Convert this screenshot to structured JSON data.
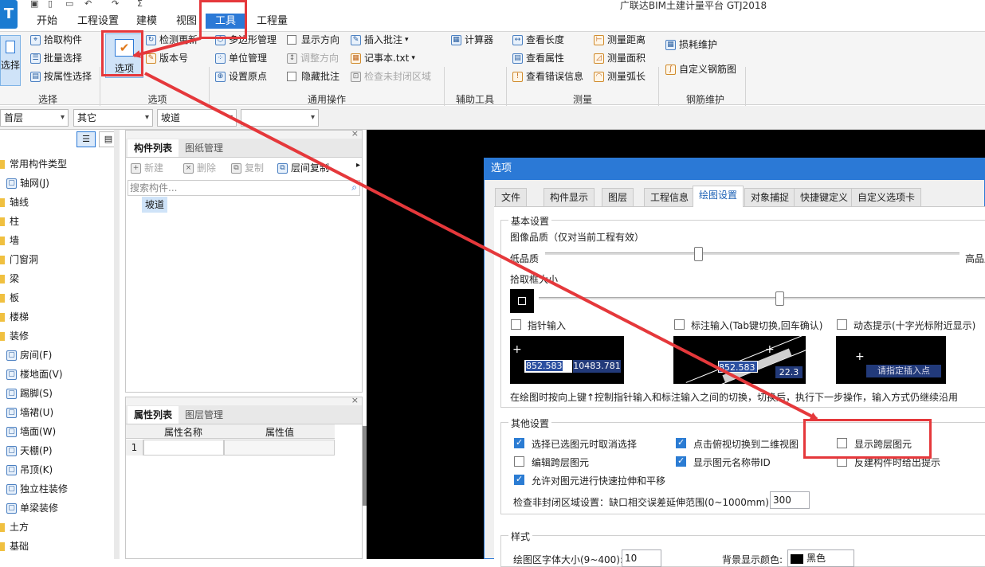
{
  "app": {
    "title": "广联达BIM土建计量平台 GTJ2018",
    "logo": "T"
  },
  "menu": [
    "开始",
    "工程设置",
    "建模",
    "视图",
    "工具",
    "工程量"
  ],
  "ribbon": {
    "select_btn": "选择",
    "select_group": {
      "items": [
        "拾取构件",
        "批量选择",
        "按属性选择"
      ],
      "label": "选择"
    },
    "options_group": {
      "big_button": "选项",
      "items": [
        "检测更新",
        "版本号"
      ],
      "label": "选项"
    },
    "common_group": {
      "col1": [
        "多边形管理",
        "单位管理",
        "设置原点"
      ],
      "col2": [
        "显示方向",
        "调整方向",
        "隐藏批注"
      ],
      "col3": [
        "插入批注",
        "记事本.txt",
        "检查未封闭区域"
      ],
      "label": "通用操作"
    },
    "aux_group": {
      "items": [
        "计算器"
      ],
      "label": "辅助工具"
    },
    "measure_group": {
      "col1": [
        "查看长度",
        "查看属性",
        "查看错误信息"
      ],
      "col2": [
        "测量距离",
        "测量面积",
        "测量弧长"
      ],
      "label": "测量"
    },
    "rebar_group": {
      "items": [
        "损耗维护",
        "自定义钢筋图"
      ],
      "label": "钢筋维护"
    }
  },
  "filters": [
    "首层",
    "其它",
    "坡道",
    ""
  ],
  "tree": [
    "常用构件类型",
    "轴网(J)",
    "轴线",
    "柱",
    "墙",
    "门窗洞",
    "梁",
    "板",
    "楼梯",
    "装修",
    "房间(F)",
    "楼地面(V)",
    "踢脚(S)",
    "墙裙(U)",
    "墙面(W)",
    "天棚(P)",
    "吊顶(K)",
    "独立柱装修",
    "单梁装修",
    "土方",
    "基础"
  ],
  "component_panel": {
    "tabs": [
      "构件列表",
      "图纸管理"
    ],
    "toolbar": [
      "新建",
      "删除",
      "复制",
      "层间复制"
    ],
    "search_placeholder": "搜索构件...",
    "items": [
      "坡道"
    ]
  },
  "property_panel": {
    "tabs": [
      "属性列表",
      "图层管理"
    ],
    "columns": [
      "属性名称",
      "属性值"
    ],
    "rows": [
      [
        "1",
        "",
        ""
      ]
    ]
  },
  "dialog": {
    "title": "选项",
    "tabs": [
      "文件",
      "构件显示",
      "图层",
      "工程信息",
      "绘图设置",
      "对象捕捉",
      "快捷键定义",
      "自定义选项卡"
    ],
    "active_tab": "绘图设置",
    "basic": {
      "group": "基本设置",
      "quality_label": "图像品质（仅对当前工程有效）",
      "low": "低品质",
      "high": "高品质",
      "pick_label": "拾取框大小",
      "quality_level": 0.37,
      "pick_level": 0.54
    },
    "inputs": {
      "pointer": "指针输入",
      "annotation": "标注输入(Tab键切换,回车确认)",
      "dynamic": "动态提示(十字光标附近显示)"
    },
    "previews": {
      "pointer_x": "852.583",
      "pointer_y": "10483.781",
      "annot_val": "852.583",
      "annot_angle": "22.3",
      "dynamic_text": "请指定插入点"
    },
    "hint": "在绘图时按向上键↑控制指针输入和标注输入之间的切换，切换后，执行下一步操作，输入方式仍继续沿用",
    "other": {
      "group": "其他设置",
      "opts": [
        {
          "label": "选择已选图元时取消选择",
          "checked": true
        },
        {
          "label": "点击俯视切换到二维视图",
          "checked": true
        },
        {
          "label": "显示跨层图元",
          "checked": false
        },
        {
          "label": "编辑跨层图元",
          "checked": false
        },
        {
          "label": "显示图元名称带ID",
          "checked": true
        },
        {
          "label": "反建构件时给出提示",
          "checked": false
        },
        {
          "label": "允许对图元进行快速拉伸和平移",
          "checked": true
        }
      ],
      "gap_label": "检查非封闭区域设置：缺口相交误差延伸范围(0~1000mm):",
      "gap_value": "300"
    },
    "style": {
      "group": "样式",
      "font_label": "绘图区字体大小(9~400):",
      "font_value": "10",
      "bg_label": "背景显示颜色:",
      "bg_value": "黑色"
    }
  },
  "colors": {
    "accent": "#2b79d6",
    "highlight": "#e5383b",
    "canvas": "#000000"
  }
}
